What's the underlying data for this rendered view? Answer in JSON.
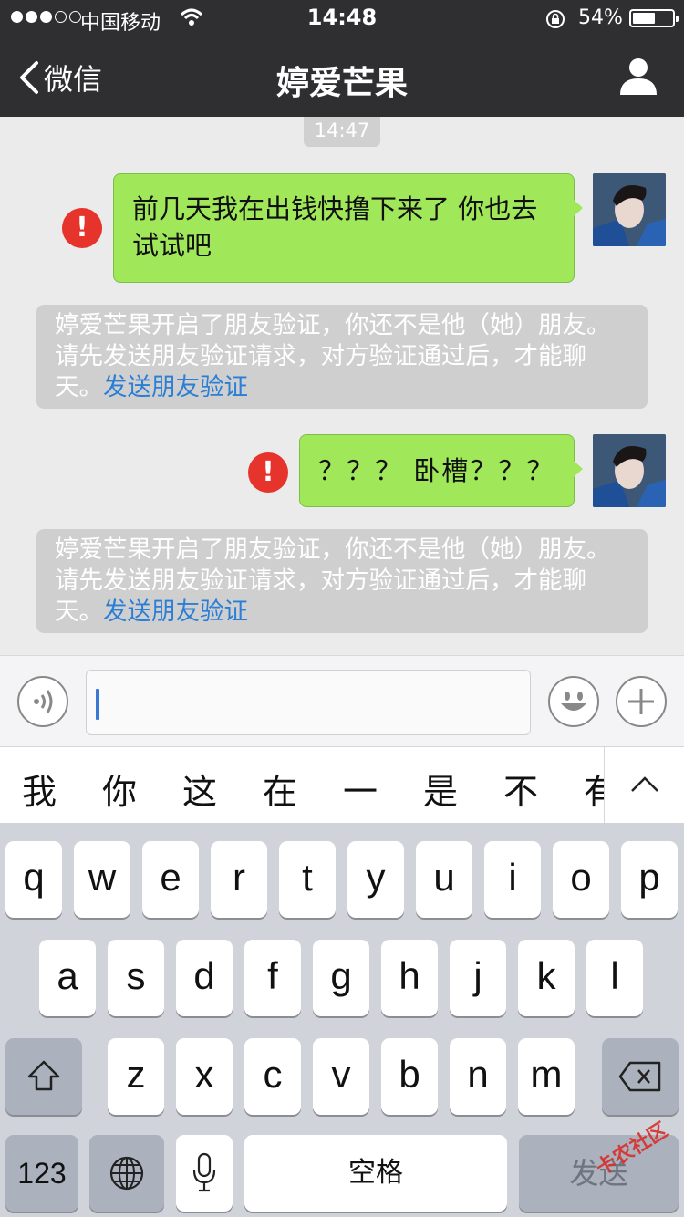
{
  "status_bar": {
    "carrier": "中国移动",
    "time": "14:48",
    "battery_percent": "54%",
    "battery_level": 0.54
  },
  "nav": {
    "back_label": "微信",
    "title": "婷爱芒果"
  },
  "chat": {
    "timestamp": "14:47",
    "messages": [
      {
        "text": "前几天我在出钱快撸下来了 你也去试试吧",
        "status": "!"
      },
      {
        "system_text": "婷爱芒果开启了朋友验证，你还不是他（她）朋友。请先发送朋友验证请求，对方验证通过后，才能聊天。",
        "link": "发送朋友验证"
      },
      {
        "text": "？？？ 卧槽？？？",
        "status": "!"
      },
      {
        "system_text": "婷爱芒果开启了朋友验证，你还不是他（她）朋友。请先发送朋友验证请求，对方验证通过后，才能聊天。",
        "link": "发送朋友验证"
      }
    ]
  },
  "input": {
    "value": ""
  },
  "candidates": [
    "我",
    "你",
    "这",
    "在",
    "一",
    "是",
    "不",
    "有"
  ],
  "keyboard": {
    "row1": [
      "q",
      "w",
      "e",
      "r",
      "t",
      "y",
      "u",
      "i",
      "o",
      "p"
    ],
    "row2": [
      "a",
      "s",
      "d",
      "f",
      "g",
      "h",
      "j",
      "k",
      "l"
    ],
    "row3": [
      "z",
      "x",
      "c",
      "v",
      "b",
      "n",
      "m"
    ],
    "numbers_label": "123",
    "space_label": "空格",
    "send_label": "发送"
  },
  "watermark": "卡农社区",
  "colors": {
    "nav_bg": "#2f2f31",
    "bubble_green": "#a0e75a",
    "error_red": "#e6332c",
    "link_blue": "#2a7ed6"
  }
}
